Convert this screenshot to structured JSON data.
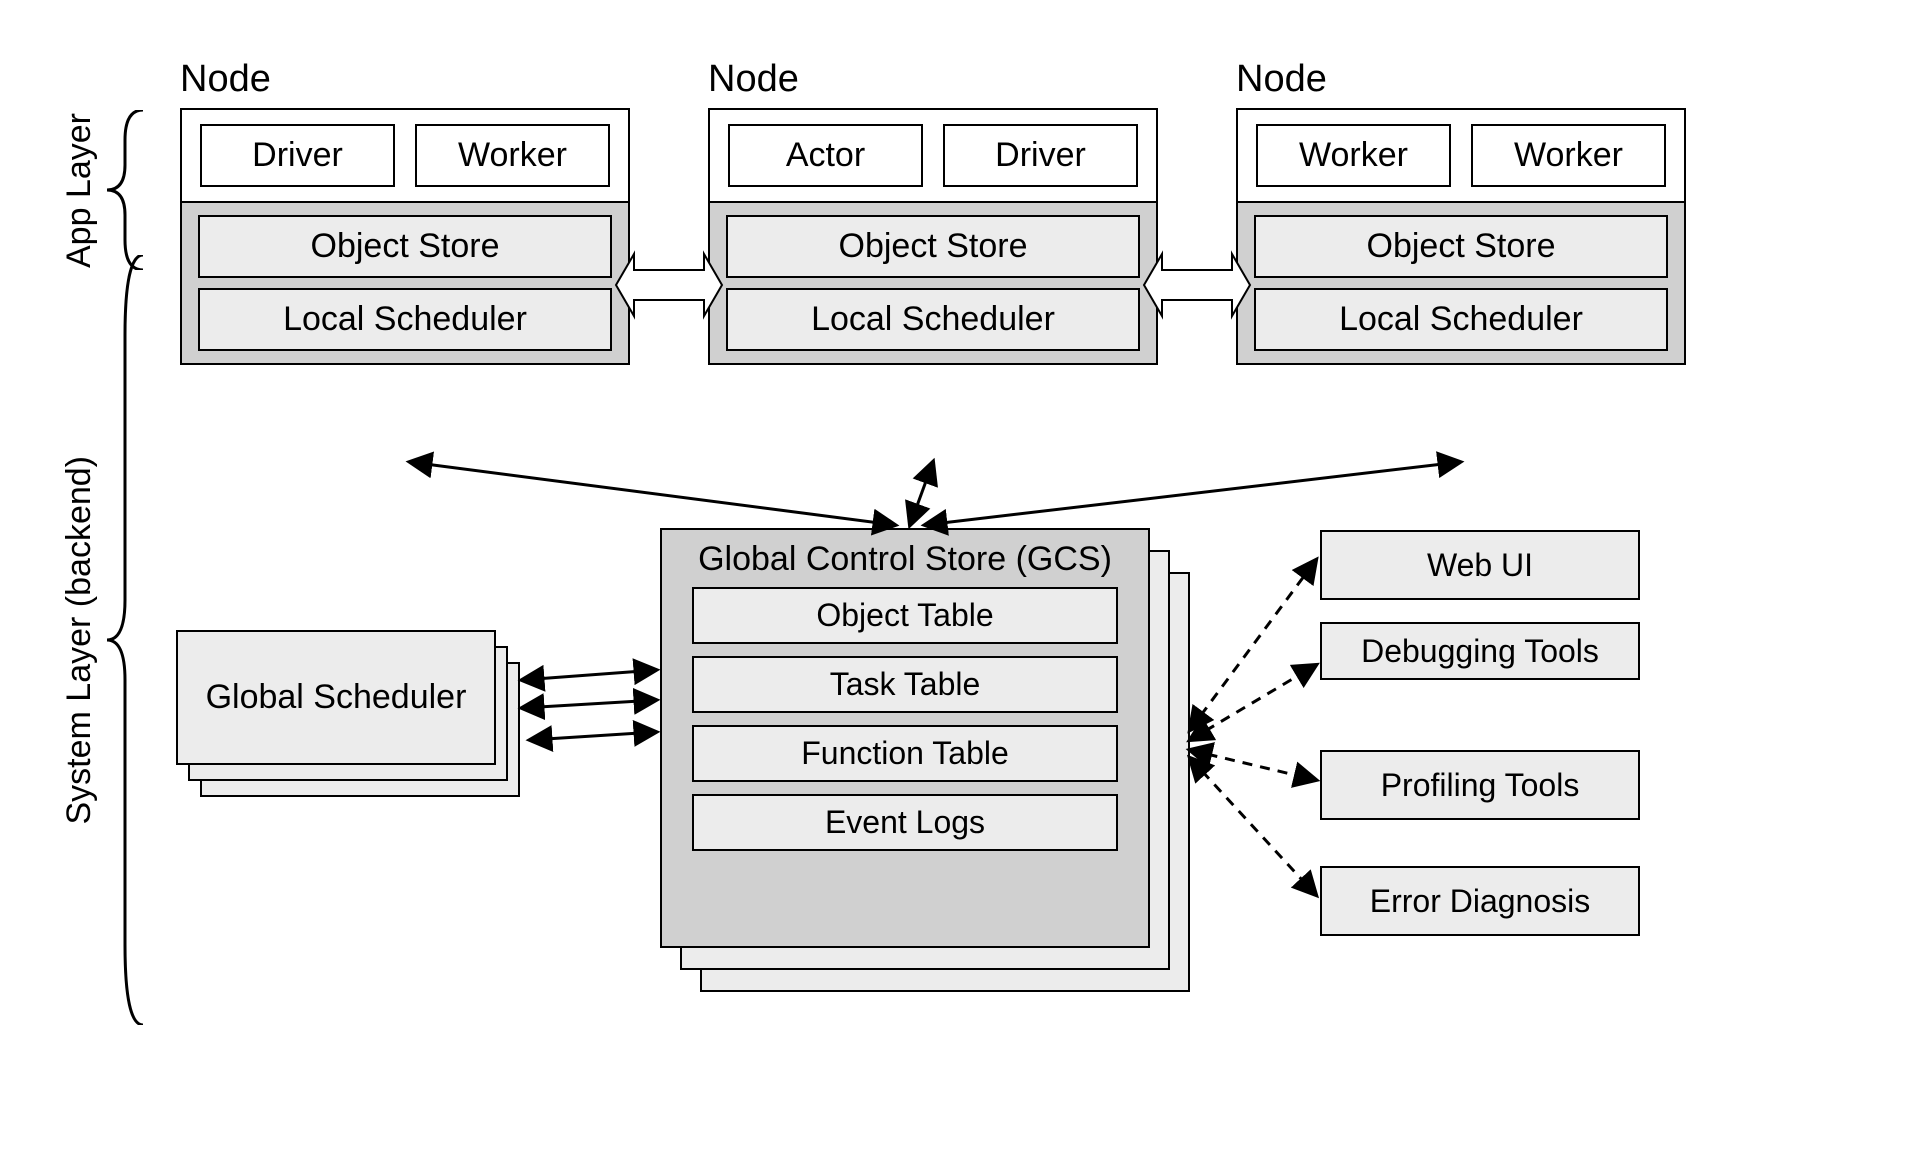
{
  "layers": {
    "app": "App Layer",
    "system": "System Layer (backend)"
  },
  "nodes": [
    {
      "title": "Node",
      "app": [
        "Driver",
        "Worker"
      ],
      "sys": [
        "Object Store",
        "Local Scheduler"
      ]
    },
    {
      "title": "Node",
      "app": [
        "Actor",
        "Driver"
      ],
      "sys": [
        "Object Store",
        "Local Scheduler"
      ]
    },
    {
      "title": "Node",
      "app": [
        "Worker",
        "Worker"
      ],
      "sys": [
        "Object Store",
        "Local Scheduler"
      ]
    }
  ],
  "gcs": {
    "title": "Global Control Store (GCS)",
    "items": [
      "Object Table",
      "Task Table",
      "Function Table",
      "Event Logs"
    ]
  },
  "global_scheduler": "Global Scheduler",
  "tools": [
    "Web UI",
    "Debugging Tools",
    "Profiling Tools",
    "Error Diagnosis"
  ]
}
